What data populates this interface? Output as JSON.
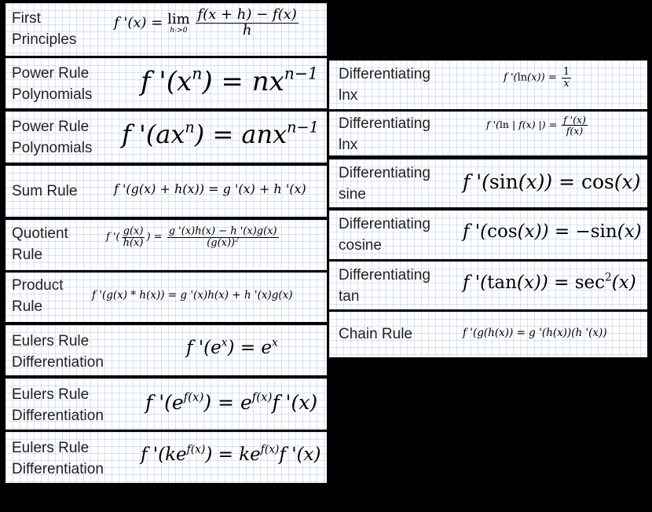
{
  "cards": [
    {
      "id": "first-principles",
      "label": "First\nPrinciples",
      "formula": "f '(x) = lim h->0 (f(x + h) − f(x)) / h"
    },
    {
      "id": "power-rule-1",
      "label": "Power Rule\nPolynomials",
      "formula": "f '(xⁿ) = nxⁿ⁻¹"
    },
    {
      "id": "power-rule-2",
      "label": "Power Rule\nPolynomials",
      "formula": "f '(axⁿ) = anxⁿ⁻¹"
    },
    {
      "id": "sum-rule",
      "label": "Sum Rule",
      "formula": "f '(g(x) + h(x)) = g '(x) + h '(x)"
    },
    {
      "id": "quotient-rule",
      "label": "Quotient\nRule",
      "formula": "f '(g(x)/h(x)) = (g '(x)h(x) − h '(x)g(x)) / (g(x))²"
    },
    {
      "id": "product-rule",
      "label": "Product\nRule",
      "formula": "f '(g(x) * h(x)) = g '(x)h(x) + h '(x)g(x)"
    },
    {
      "id": "eulers-rule-1",
      "label": "Eulers Rule\nDifferentiation",
      "formula": "f '(eˣ) = eˣ"
    },
    {
      "id": "eulers-rule-2",
      "label": "Eulers Rule\nDifferentiation",
      "formula": "f '(e^f(x)) = e^f(x) f '(x)"
    },
    {
      "id": "eulers-rule-3",
      "label": "Eulers Rule\nDifferentiation",
      "formula": "f '(ke^f(x)) = ke^f(x) f '(x)"
    },
    {
      "id": "diff-lnx-1",
      "label": "Differentiating\nlnx",
      "formula": "f '(ln(x)) = 1/x"
    },
    {
      "id": "diff-lnx-2",
      "label": "Differentiating\nlnx",
      "formula": "f '(ln | f(x) |) = f '(x)/f(x)"
    },
    {
      "id": "diff-sine",
      "label": "Differentiating\nsine",
      "formula": "f '(sin(x)) = cos(x)"
    },
    {
      "id": "diff-cosine",
      "label": "Differentiating\ncosine",
      "formula": "f '(cos(x)) = −sin(x)"
    },
    {
      "id": "diff-tan",
      "label": "Differentiating\ntan",
      "formula": "f '(tan(x)) = sec²(x)"
    },
    {
      "id": "chain-rule",
      "label": "Chain Rule",
      "formula": "f '(g(h(x)) = g '(h(x))(h '(x))"
    }
  ]
}
